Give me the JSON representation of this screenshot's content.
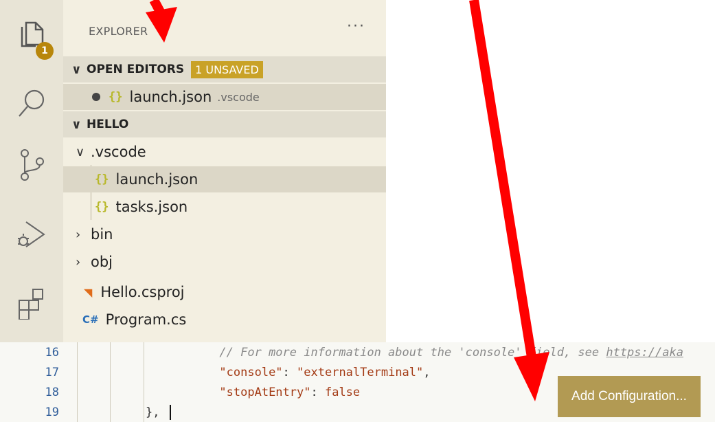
{
  "activity_bar": {
    "explorer_badge": "1",
    "icons": [
      "files-icon",
      "search-icon",
      "source-control-icon",
      "run-debug-icon",
      "extensions-icon"
    ]
  },
  "sidebar": {
    "title": "EXPLORER",
    "more": "···",
    "open_editors": {
      "label": "OPEN EDITORS",
      "badge": "1 UNSAVED",
      "items": [
        {
          "name": "launch.json",
          "desc": ".vscode"
        }
      ]
    },
    "workspace": {
      "label": "HELLO",
      "folder": ".vscode",
      "files_in_folder": [
        "launch.json",
        "tasks.json"
      ],
      "folders": [
        "bin",
        "obj"
      ],
      "files": [
        "Hello.csproj",
        "Program.cs"
      ]
    }
  },
  "editor": {
    "lines": [
      {
        "num": "16",
        "comment": "// For more information about the 'console' field, see ",
        "link": "https://aka"
      },
      {
        "num": "17",
        "key": "\"console\"",
        "sep": ": ",
        "value": "\"externalTerminal\"",
        "end": ","
      },
      {
        "num": "18",
        "key": "\"stopAtEntry\"",
        "sep": ": ",
        "value": "false",
        "end": ""
      },
      {
        "num": "19",
        "text": "},"
      }
    ]
  },
  "add_configuration": "Add Configuration...",
  "colors": {
    "arrow": "#ff0000",
    "badge": "#c9a227",
    "button": "#b29a53"
  }
}
